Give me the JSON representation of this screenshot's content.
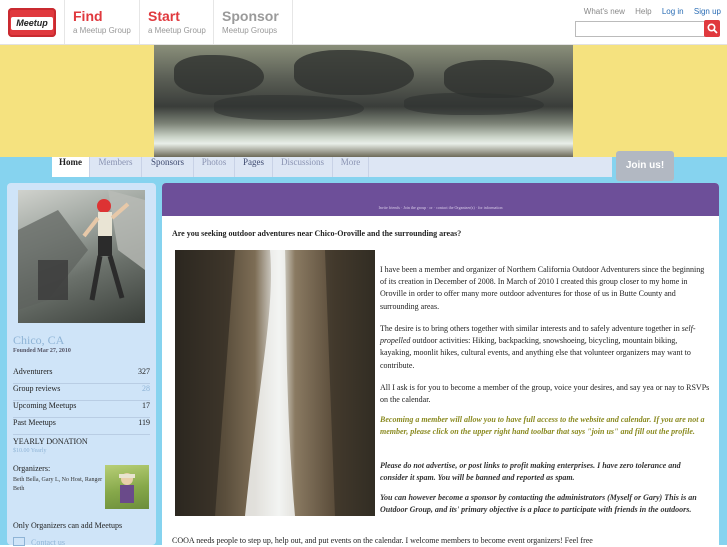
{
  "header": {
    "logo_text": "Meetup",
    "nav": [
      {
        "big": "Find",
        "small": "a Meetup Group"
      },
      {
        "big": "Start",
        "small": "a Meetup Group"
      },
      {
        "big": "Sponsor",
        "small": "Meetup Groups"
      }
    ],
    "links": {
      "whats_new": "What's new",
      "help": "Help",
      "login": "Log in",
      "signup": "Sign up"
    },
    "search_placeholder": ""
  },
  "tabs": [
    "Home",
    "Members",
    "Sponsors",
    "Photos",
    "Pages",
    "Discussions",
    "More"
  ],
  "join_label": "Join us!",
  "sidebar": {
    "city": "Chico, CA",
    "founded": "Founded Mar 27, 2010",
    "stats": [
      {
        "label": "Adventurers",
        "value": "327"
      },
      {
        "label": "Group reviews",
        "value": "28"
      },
      {
        "label": "Upcoming Meetups",
        "value": "17"
      },
      {
        "label": "Past Meetups",
        "value": "119"
      }
    ],
    "yearly_donation": "YEARLY DONATION",
    "yearly_sub": "$10.00 Yearly",
    "organizers_label": "Organizers:",
    "organizers_names": "Beth Bella, Gary L, No Host, Ranger Beth",
    "only_organizers": "Only Organizers can add Meetups",
    "contact": "Contact us"
  },
  "main": {
    "purple_text": "Invite friends · Join the group · or · contact the Organizer(s) · for information",
    "intro": "Are you seeking outdoor adventures near Chico-Oroville and the surrounding areas?",
    "p1": "I have been a member and organizer of Northern California Outdoor Adventurers since the beginning of its creation in December of 2008. In March of 2010 I created this group closer to my home in Oroville in order to offer many more outdoor adventures for those of us in Butte County and surrounding areas.",
    "p2a": "The desire is to bring others together with similar interests and to safely adventure together in ",
    "p2_em": "self-propelled",
    "p2b": " outdoor activities: Hiking, backpacking, snowshoeing, bicycling, mountain biking, kayaking, moonlit hikes, cultural events, and anything else that volunteer organizers may want to contribute.",
    "p3": "All I ask is for you to become a member of the group, voice your desires, and say yea or nay to RSVPs on the calendar.",
    "p4": "Becoming a member will allow you to have full access to the website and calendar. If you are not a member, please click on the upper right hand toolbar that says \"join us\" and fill out the profile.",
    "p5": "Please do not advertise, or post links to profit making enterprises.  I have zero tolerance and consider it spam.  You will be banned and reported as spam.",
    "p6": "You can however become a sponsor by contacting the administrators (Myself or Gary)  This is an Outdoor Group, and its' primary objective is a place to participate with friends in the outdoors.",
    "p7": "COOA needs people to step up, help out, and put events on the calendar. I welcome members to become event organizers! Feel free"
  },
  "colors": {
    "brand": "#e0393e",
    "banner": "#f5e27f",
    "sky": "#86d3ef",
    "purple": "#6d4f99",
    "sidebar": "#cfe4f8"
  }
}
